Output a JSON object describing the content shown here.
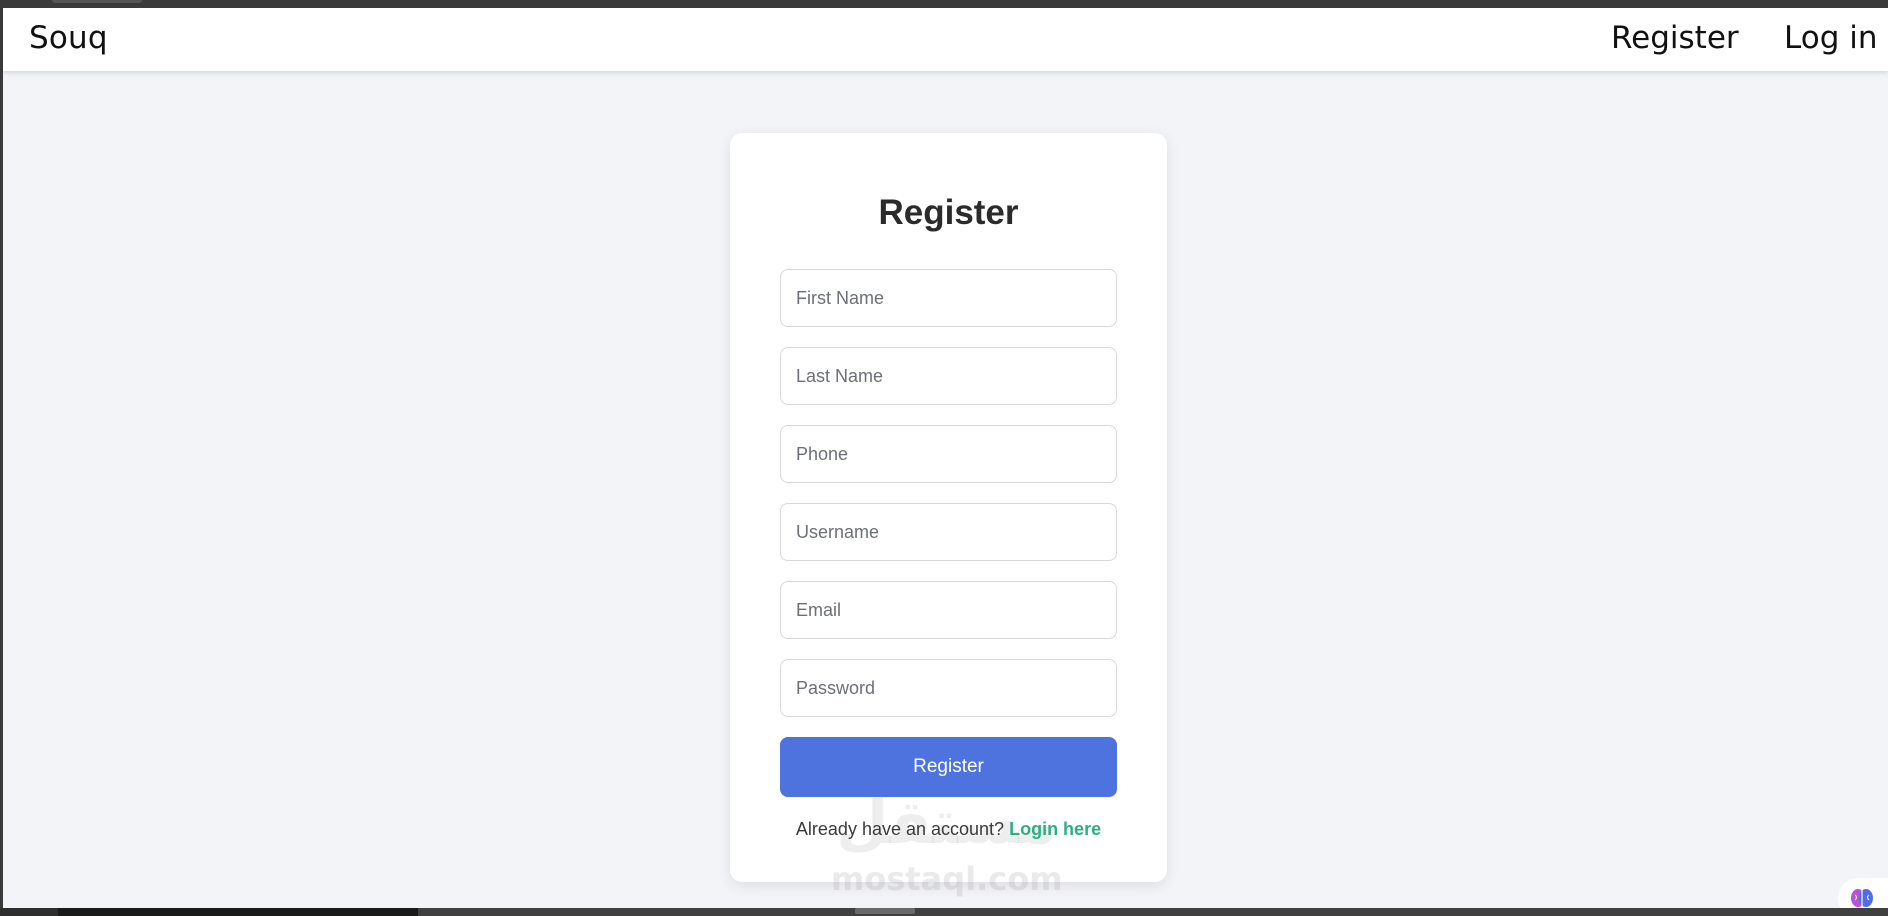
{
  "navbar": {
    "brand": "Souq",
    "links": {
      "register": "Register",
      "login": "Log in"
    }
  },
  "form": {
    "title": "Register",
    "fields": {
      "first_name": {
        "placeholder": "First Name",
        "value": ""
      },
      "last_name": {
        "placeholder": "Last Name",
        "value": ""
      },
      "phone": {
        "placeholder": "Phone",
        "value": ""
      },
      "username": {
        "placeholder": "Username",
        "value": ""
      },
      "email": {
        "placeholder": "Email",
        "value": ""
      },
      "password": {
        "placeholder": "Password",
        "value": ""
      }
    },
    "submit_label": "Register",
    "footer_text": "Already have an account?",
    "footer_link": "Login here"
  },
  "watermark": {
    "arabic": "مستقل",
    "latin": "mostaql.com"
  },
  "colors": {
    "page_bg": "#f3f4f8",
    "button": "#4e73df",
    "link": "#2fae86",
    "title": "#2b2b2b"
  },
  "icons": {
    "extension": "brain-icon"
  }
}
